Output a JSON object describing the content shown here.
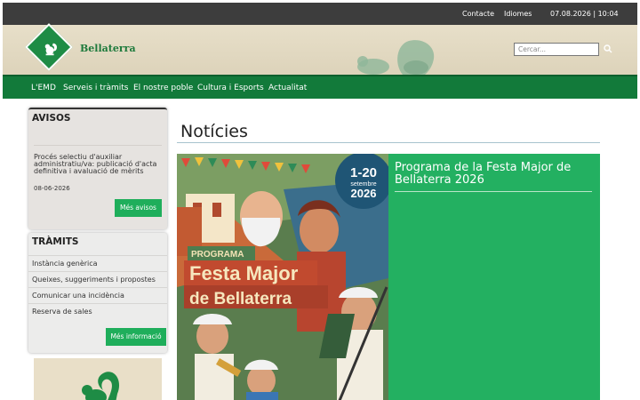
{
  "topbar": {
    "contact": "Contacte",
    "languages": "Idiomes",
    "datetime": "07.08.2026 | 10:04"
  },
  "header": {
    "brand": "Bellaterra",
    "search_placeholder": "Cercar...",
    "search_icon": "search-icon"
  },
  "nav": {
    "items": [
      "L'EMD",
      "Serveis i tràmits",
      "El nostre poble",
      "Cultura i Esports",
      "Actualitat"
    ]
  },
  "avisos": {
    "title": "AVISOS",
    "notice": "Procés selectiu d'auxiliar administratiu/va: publicació d'acta definitiva i avaluació de mèrits",
    "date": "08-06-2026",
    "more_button": "Més avisos"
  },
  "tramits": {
    "title": "TRÀMITS",
    "items": [
      "Instància genèrica",
      "Queixes, suggeriments i propostes",
      "Comunicar una incidència",
      "Reserva de sales"
    ],
    "more_button": "Més informació"
  },
  "main": {
    "title": "Notícies",
    "news": {
      "title": "Programa de la Festa Major de Bellaterra 2026",
      "poster": {
        "date_range": "1-20",
        "month": "setembre",
        "year": "2026",
        "kicker": "PROGRAMA",
        "line1": "Festa Major",
        "line2": "de Bellaterra"
      }
    }
  },
  "colors": {
    "nav_green": "#127a3a",
    "button_green": "#1fae5b",
    "news_panel": "#23b061",
    "topbar": "#3d3d3d"
  }
}
